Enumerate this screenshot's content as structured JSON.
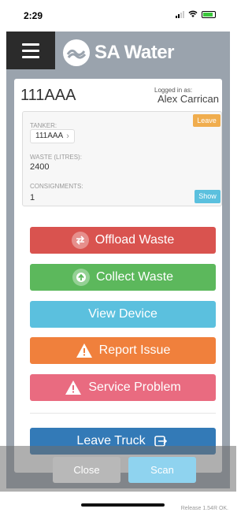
{
  "status": {
    "time": "2:29"
  },
  "header": {
    "brand": "SA Water"
  },
  "card": {
    "truck_id": "111AAA",
    "logged_in_label": "Logged in as:",
    "user_name": "Alex Carrican"
  },
  "panel": {
    "tanker_label": "TANKER:",
    "tanker_value": "111AAA",
    "waste_label": "WASTE (LITRES):",
    "waste_value": "2400",
    "consignments_label": "CONSIGNMENTS:",
    "consignments_value": "1",
    "leave_label": "Leave",
    "show_label": "Show"
  },
  "actions": {
    "offload": "Offload Waste",
    "collect": "Collect Waste",
    "device": "View Device",
    "report": "Report Issue",
    "service": "Service Problem",
    "leave_truck": "Leave Truck"
  },
  "footer": {
    "close": "Close",
    "scan": "Scan",
    "release": "Release 1.54R OK."
  },
  "colors": {
    "offload": "#d9534f",
    "collect": "#5cb85c",
    "device": "#5bc0de",
    "report": "#f0803c",
    "service": "#e96b80",
    "leave_truck": "#337ab7"
  }
}
